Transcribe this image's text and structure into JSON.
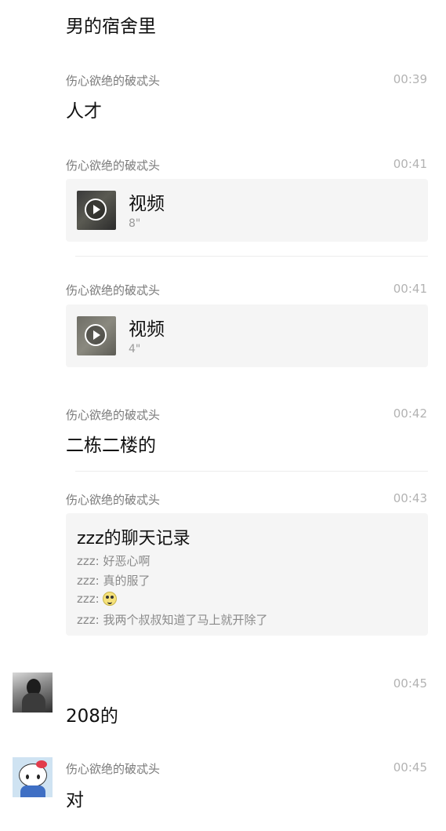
{
  "top_text": "男的宿舍里",
  "messages": [
    {
      "sender": "伤心欲绝的破忒头",
      "time": "00:39",
      "text": "人才"
    },
    {
      "sender": "伤心欲绝的破忒头",
      "time": "00:41",
      "video_title": "视频",
      "video_duration": "8\""
    },
    {
      "sender": "伤心欲绝的破忒头",
      "time": "00:41",
      "video_title": "视频",
      "video_duration": "4\""
    },
    {
      "sender": "伤心欲绝的破忒头",
      "time": "00:42",
      "text": "二栋二楼的"
    },
    {
      "sender": "伤心欲绝的破忒头",
      "time": "00:43",
      "record_title": "zzz的聊天记录",
      "record_lines": [
        "zzz: 好恶心啊",
        "zzz: 真的服了",
        "zzz:",
        "zzz: 我两个叔叔知道了马上就开除了"
      ]
    },
    {
      "sender": "",
      "time": "00:45",
      "text": "208的"
    },
    {
      "sender": "伤心欲绝的破忒头",
      "time": "00:45",
      "text": "对"
    }
  ],
  "icons": {
    "play": "play-icon",
    "emoji": "smile-emoji-icon",
    "avatar1": "user-avatar-photo",
    "avatar2": "hello-kitty-avatar"
  }
}
